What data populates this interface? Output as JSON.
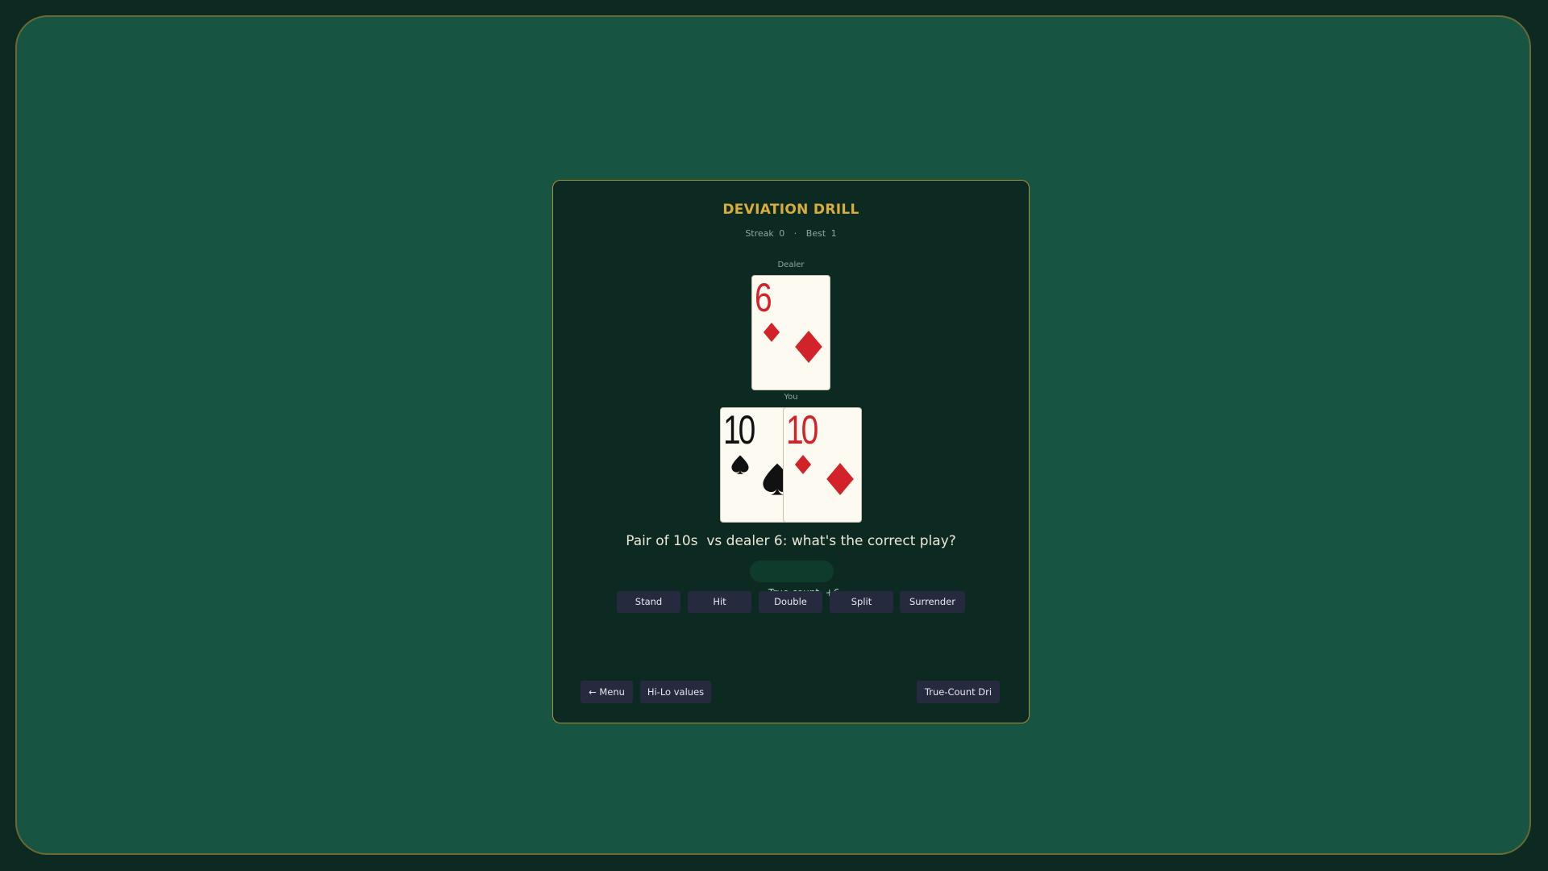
{
  "colors": {
    "felt": "#175442",
    "felt_border": "#6a6a34",
    "panel": "#0c2a21",
    "panel_border": "#a98f3c",
    "title": "#d9ad3c",
    "button_bg": "#262a3e",
    "card_red": "#d2232a",
    "card_black": "#111111",
    "true_count_text": "#a9ddb2"
  },
  "drill": {
    "title": "DEVIATION DRILL",
    "streak_label": "Streak",
    "streak_value": "0",
    "separator": "·",
    "best_label": "Best",
    "best_value": "1"
  },
  "dealer": {
    "label": "Dealer",
    "cards": [
      {
        "rank": "6",
        "suit": "diamonds",
        "color": "red",
        "icon": "diamond-icon"
      }
    ]
  },
  "player": {
    "label": "You",
    "cards": [
      {
        "rank": "10",
        "suit": "spades",
        "color": "black",
        "icon": "spade-icon"
      },
      {
        "rank": "10",
        "suit": "diamonds",
        "color": "red",
        "icon": "diamond-icon"
      }
    ]
  },
  "question": "Pair of 10s  vs dealer 6: what's the correct play?",
  "true_count": {
    "label": "True count",
    "value": "+6"
  },
  "actions": {
    "stand": "Stand",
    "hit": "Hit",
    "double": "Double",
    "split": "Split",
    "surrender": "Surrender"
  },
  "footer": {
    "menu": "← Menu",
    "hilo": "Hi-Lo values",
    "next_drill": "True-Count Dri"
  }
}
